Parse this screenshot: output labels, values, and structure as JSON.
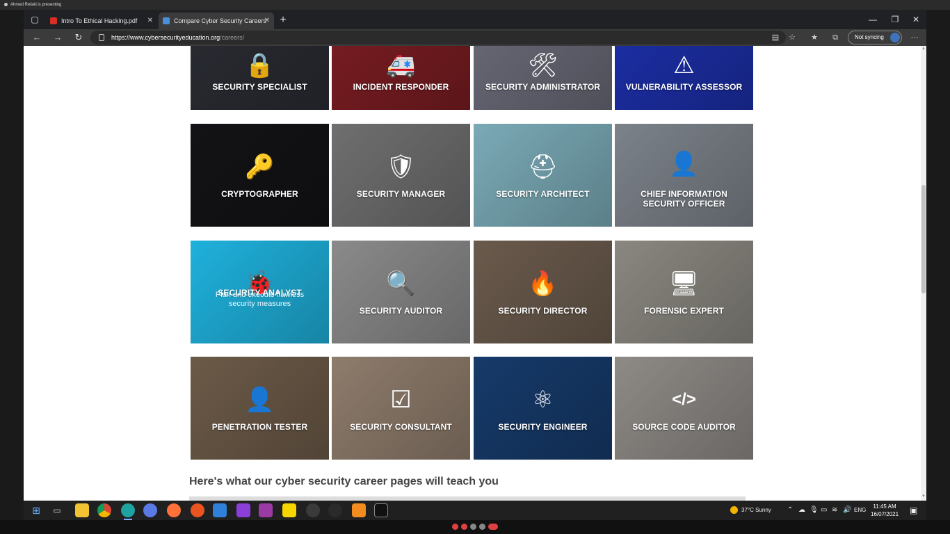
{
  "presenter": {
    "text": "Ahmed Refaki is presenting"
  },
  "browser": {
    "tabs": [
      {
        "label": "Intro To Ethical Hacking.pdf",
        "active": false
      },
      {
        "label": "Compare Cyber Security Careers",
        "active": true
      }
    ],
    "url_domain": "https://www.cybersecurityeducation.org",
    "url_path": "/careers/",
    "sync_label": "Not syncing"
  },
  "careers": [
    {
      "label": "SECURITY SPECIALIST",
      "icon": "lock-icon",
      "glyph": "🔒",
      "bg": "#2a2c33"
    },
    {
      "label": "INCIDENT RESPONDER",
      "icon": "ambulance-icon",
      "glyph": "🚑",
      "bg": "#7a1d22"
    },
    {
      "label": "SECURITY ADMINISTRATOR",
      "icon": "tools-icon",
      "glyph": "🛠",
      "bg": "#6a6a78"
    },
    {
      "label": "VULNERABILITY ASSESSOR",
      "icon": "warning-icon",
      "glyph": "⚠",
      "bg": "#1c2fa8"
    },
    {
      "label": "CRYPTOGRAPHER",
      "icon": "key-icon",
      "glyph": "🔑",
      "bg": "#131316"
    },
    {
      "label": "SECURITY MANAGER",
      "icon": "shield-icon",
      "glyph": "🛡",
      "bg": "#6f6f6f"
    },
    {
      "label": "SECURITY ARCHITECT",
      "icon": "hardhat-icon",
      "glyph": "⛑",
      "bg": "#7aaab6"
    },
    {
      "label": "CHIEF INFORMATION SECURITY OFFICER",
      "icon": "user-circle-icon",
      "glyph": "👤",
      "bg": "#7c828a"
    },
    {
      "label": "SECURITY ANALYST",
      "icon": "bug-icon",
      "glyph": "🐞",
      "bg": "#1fb1dc",
      "hover_text": "Plan and execute flawless security measures"
    },
    {
      "label": "SECURITY AUDITOR",
      "icon": "magnifier-icon",
      "glyph": "🔍",
      "bg": "#8a8a8a"
    },
    {
      "label": "SECURITY DIRECTOR",
      "icon": "fire-icon",
      "glyph": "🔥",
      "bg": "#6a5a4c"
    },
    {
      "label": "FORENSIC EXPERT",
      "icon": "monitor-icon",
      "glyph": "🖥",
      "bg": "#8a8780"
    },
    {
      "label": "PENETRATION TESTER",
      "icon": "hacker-icon",
      "glyph": "👤",
      "bg": "#6c5a48"
    },
    {
      "label": "SECURITY CONSULTANT",
      "icon": "checkbox-icon",
      "glyph": "☑",
      "bg": "#8e7c6c"
    },
    {
      "label": "SECURITY ENGINEER",
      "icon": "network-icon",
      "glyph": "⚛",
      "bg": "#163a6a"
    },
    {
      "label": "SOURCE CODE AUDITOR",
      "icon": "code-icon",
      "glyph": "</>",
      "bg": "#8e8a86"
    }
  ],
  "heading": "Here's what our cyber security career pages will teach you",
  "taskbar": {
    "weather": "37°C  Sunny",
    "lang": "ENG",
    "time": "11:45 AM",
    "date": "16/07/2021"
  }
}
